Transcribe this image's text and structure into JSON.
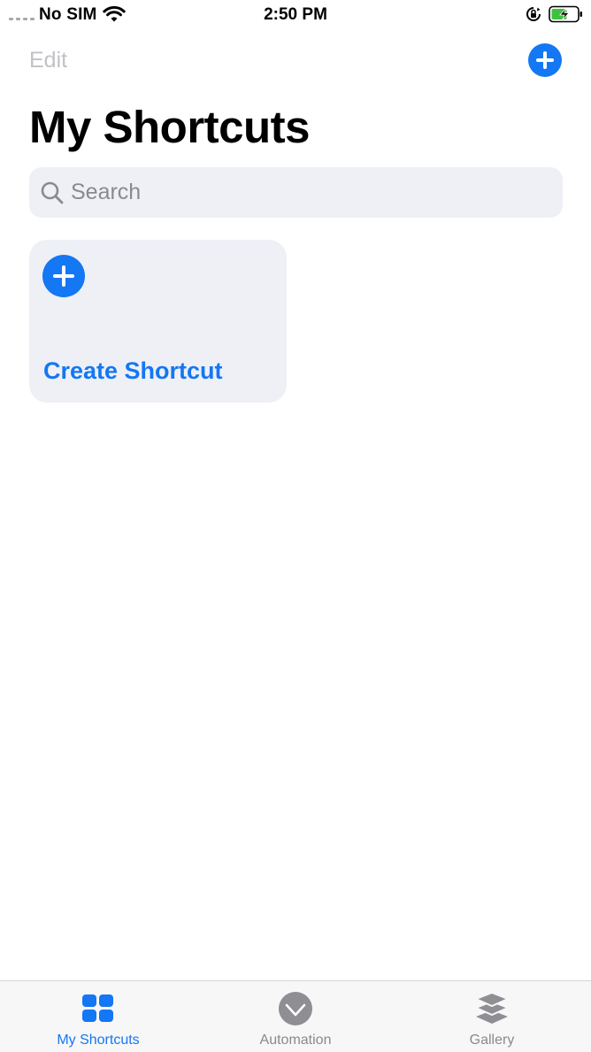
{
  "status_bar": {
    "carrier": "No SIM",
    "time": "2:50 PM"
  },
  "nav": {
    "edit_label": "Edit"
  },
  "page": {
    "title": "My Shortcuts"
  },
  "search": {
    "placeholder": "Search"
  },
  "create_card": {
    "label": "Create Shortcut"
  },
  "tabs": [
    {
      "label": "My Shortcuts",
      "icon": "grid-icon",
      "active": true
    },
    {
      "label": "Automation",
      "icon": "check-circle-icon",
      "active": false
    },
    {
      "label": "Gallery",
      "icon": "layers-icon",
      "active": false
    }
  ],
  "colors": {
    "accent": "#1477f3",
    "card_bg": "#eef0f6",
    "disabled_text": "#c2c2c6",
    "inactive_tab": "#8a8a8e"
  }
}
